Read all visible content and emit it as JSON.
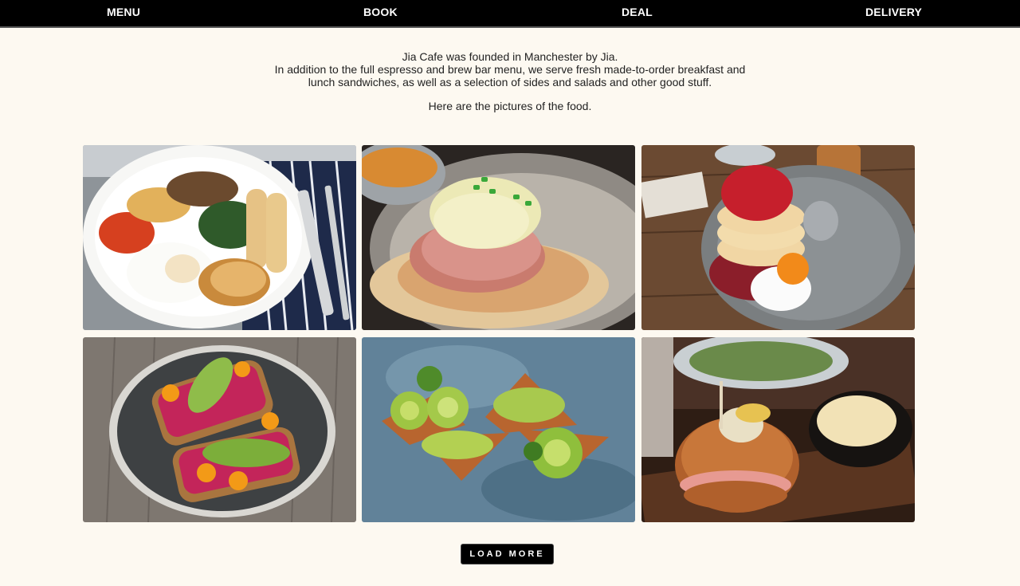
{
  "nav": {
    "items": [
      "MENU",
      "BOOK",
      "DEAL",
      "DELIVERY"
    ]
  },
  "intro": {
    "line1": "Jia Cafe was founded in Manchester by Jia.",
    "line2": "In addition to the full espresso and brew bar menu, we serve fresh made-to-order breakfast and",
    "line3": "lunch sandwiches, as well as a selection of sides and salads and other good stuff.",
    "line4": "Here are the pictures of the food."
  },
  "gallery": {
    "photos": [
      {
        "name": "full-english-breakfast-photo"
      },
      {
        "name": "eggs-benedict-photo"
      },
      {
        "name": "berry-pancakes-photo"
      },
      {
        "name": "avocado-beet-toast-photo"
      },
      {
        "name": "avocado-rose-toast-photo"
      },
      {
        "name": "bagel-sandwich-photo"
      }
    ]
  },
  "load_more_label": "LOAD MORE",
  "colors": {
    "background": "#fdf9f1",
    "nav_background": "#000000",
    "nav_text": "#ffffff",
    "button_background": "#000000"
  }
}
